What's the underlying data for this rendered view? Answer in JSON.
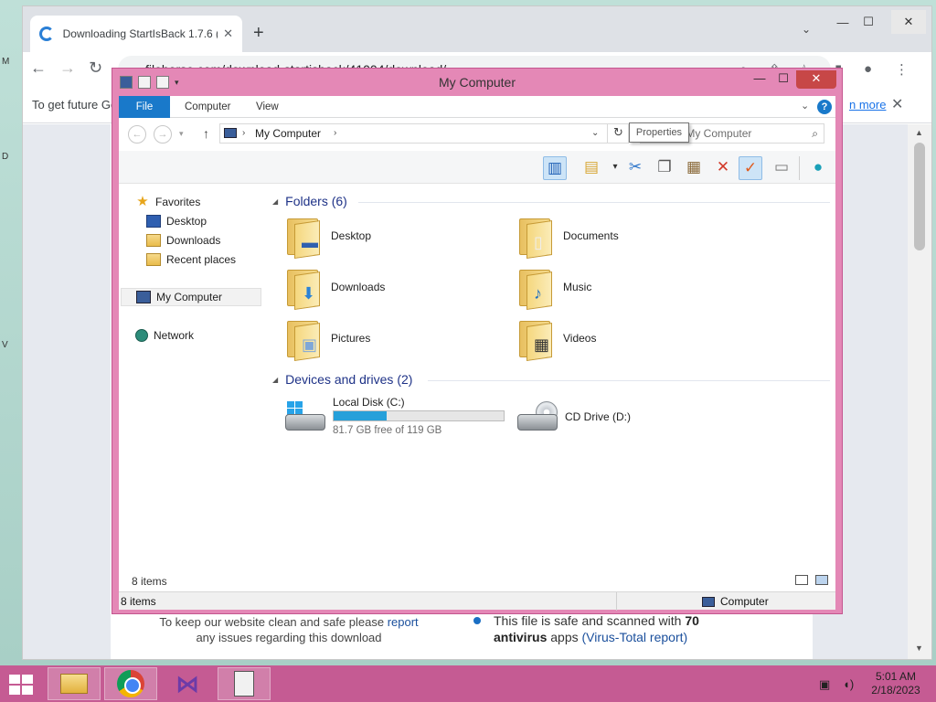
{
  "desktop": {
    "left_marks": [
      "M",
      "D",
      "V"
    ]
  },
  "browser": {
    "tab_title": "Downloading StartIsBack 1.7.6 (f",
    "tab_close": "✕",
    "new_tab": "+",
    "url": "filehorse.com/download-startisback/41004/download/",
    "window_min": "—",
    "window_max": "☐",
    "window_close": "✕",
    "infobar_text": "To get future Go",
    "infobar_link": "n more",
    "infobar_close": "✕"
  },
  "page": {
    "note_line1": "To keep our website clean and safe please",
    "note_link": "report",
    "note_line2": "any issues regarding this download",
    "safe_text1": "This file is safe and scanned with",
    "safe_count": "70",
    "safe_bold2": "antivirus",
    "safe_text2": "apps",
    "safe_link": "(Virus-Total report)"
  },
  "explorer": {
    "title": "My Computer",
    "min": "—",
    "max": "☐",
    "close": "✕",
    "ribbon_tabs": [
      "File",
      "Computer",
      "View"
    ],
    "help": "?",
    "address": "My Computer",
    "search_placeholder": "Search My Computer",
    "tooltip": "Properties",
    "nav": {
      "favorites": "Favorites",
      "desktop": "Desktop",
      "downloads": "Downloads",
      "recent": "Recent places",
      "computer": "My Computer",
      "network": "Network"
    },
    "folders_header": "Folders (6)",
    "folders": [
      {
        "name": "Desktop"
      },
      {
        "name": "Documents"
      },
      {
        "name": "Downloads"
      },
      {
        "name": "Music"
      },
      {
        "name": "Pictures"
      },
      {
        "name": "Videos"
      }
    ],
    "drives_header": "Devices and drives (2)",
    "drives": [
      {
        "name": "Local Disk (C:)",
        "free_text": "81.7 GB free of 119 GB",
        "used_fraction": 0.313
      },
      {
        "name": "CD Drive (D:)"
      }
    ],
    "items_count": "8 items",
    "status_left": "8 items",
    "status_right": "Computer",
    "accent": "#1979ca",
    "border_color": "#e488b6"
  },
  "taskbar": {
    "time": "5:01 AM",
    "date": "2/18/2023",
    "color": "#c55b93"
  }
}
